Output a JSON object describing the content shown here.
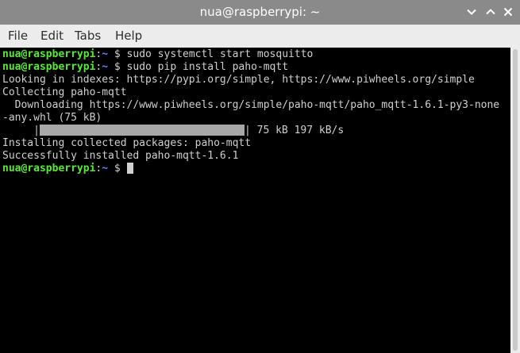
{
  "window": {
    "title": "nua@raspberrypi: ~"
  },
  "menu": {
    "items": [
      "File",
      "Edit",
      "Tabs",
      "Help"
    ]
  },
  "prompt": {
    "user": "nua@raspberrypi",
    "sep": ":",
    "path": "~",
    "dollar": " $ "
  },
  "terminal": {
    "cmd1": "sudo systemctl start mosquitto",
    "cmd2": "sudo pip install paho-mqtt",
    "out1": "Looking in indexes: https://pypi.org/simple, https://www.piwheels.org/simple",
    "out2": "Collecting paho-mqtt",
    "out3": "  Downloading https://www.piwheels.org/simple/paho-mqtt/paho_mqtt-1.6.1-py3-none",
    "out4": "-any.whl (75 kB)",
    "progress_lead": "     |",
    "progress_tail": "| 75 kB 197 kB/s",
    "progress_fraction": 1.0,
    "out6": "Installing collected packages: paho-mqtt",
    "out7": "Successfully installed paho-mqtt-1.6.1"
  },
  "colors": {
    "prompt_user": "#59e83a",
    "prompt_path": "#6b7cff",
    "terminal_bg": "#000000",
    "text": "#cfcfcf",
    "titlebar": "#8a8a8a"
  }
}
